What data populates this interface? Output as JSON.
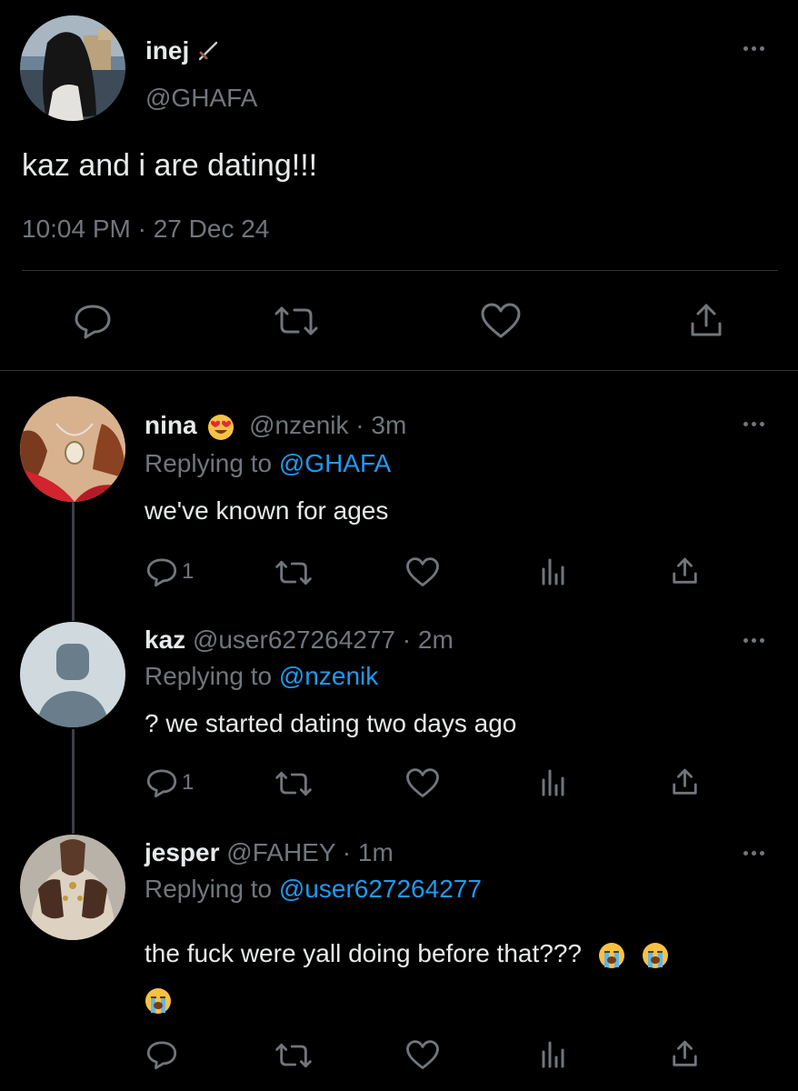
{
  "main_tweet": {
    "display_name": "inej",
    "name_emoji": "dagger-icon",
    "handle": "@GHAFA",
    "text": "kaz and i are dating!!!",
    "timestamp": "10:04 PM · 27 Dec 24"
  },
  "replies": [
    {
      "display_name": "nina",
      "name_emoji": "heart-eyes-emoji",
      "handle": "@nzenik",
      "age": "· 3m",
      "replying_prefix": "Replying to",
      "replying_to": "@GHAFA",
      "text": "we've known for ages",
      "reply_count": "1"
    },
    {
      "display_name": "kaz",
      "handle": "@user627264277",
      "age": "· 2m",
      "replying_prefix": "Replying to",
      "replying_to": "@nzenik",
      "text": "? we started dating two days ago",
      "reply_count": "1"
    },
    {
      "display_name": "jesper",
      "handle": "@FAHEY",
      "age": "· 1m",
      "replying_prefix": "Replying to",
      "replying_to": "@user627264277",
      "text": "the fuck were yall doing before that???",
      "text_emojis": [
        "loudly-crying-emoji",
        "loudly-crying-emoji",
        "loudly-crying-emoji"
      ]
    }
  ],
  "colors": {
    "background": "#000000",
    "text": "#e7e9ea",
    "muted": "#71767b",
    "link": "#1d9bf0"
  }
}
